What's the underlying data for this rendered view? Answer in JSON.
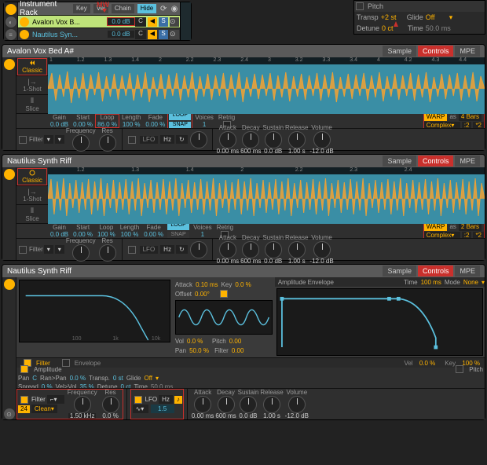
{
  "rack": {
    "title": "Instrument Rack",
    "buttons": {
      "key": "Key",
      "vel": "Vel",
      "chain": "Chain",
      "hide": "Hide"
    },
    "mw_label": "MW",
    "chains": [
      {
        "name": "Avalon Vox B...",
        "vol": "0.0 dB",
        "pan": "C",
        "mute": "",
        "solo": "S",
        "selected": true,
        "vol_hl": true
      },
      {
        "name": "Nautilus Syn...",
        "vol": "0.0 dB",
        "pan": "C",
        "mute": "",
        "solo": "S",
        "selected": false
      }
    ]
  },
  "pitch": {
    "header": "Pitch",
    "transp_label": "Transp",
    "transp_val": "+2 st",
    "glide_label": "Glide",
    "glide_val": "Off",
    "detune_label": "Detune",
    "detune_val": "0 ct",
    "time_label": "Time",
    "time_val": "50.0 ms"
  },
  "tabs": {
    "sample": "Sample",
    "controls": "Controls",
    "mpe": "MPE"
  },
  "left_tabs": {
    "classic": "Classic",
    "oneshot": "1-Shot",
    "slice": "Slice"
  },
  "knob_labels": {
    "gain": "Gain",
    "start": "Start",
    "loop": "Loop",
    "length": "Length",
    "fade": "Fade",
    "voices": "Voices",
    "retrig": "Retrig",
    "filter": "Filter",
    "freq": "Frequency",
    "res": "Res",
    "lfo": "LFO",
    "attack": "Attack",
    "decay": "Decay",
    "sustain": "Sustain",
    "release": "Release",
    "volume": "Volume",
    "vel": "Vel",
    "key": "Key",
    "vol": "Vol",
    "pitch": "Pitch",
    "pan": "Pan",
    "env": "Envelope",
    "offset": "Offset",
    "hz": "Hz",
    "rand": "R",
    "loop_btn": "LOOP",
    "snap_btn": "SNAP",
    "warp": "WARP",
    "as": "as",
    "complex": "Complex",
    "bars4": "4 Bars",
    "bars2": "2 Bars",
    "div2": ":2",
    "mul2": "*2",
    "clean": "Clean",
    "amp": "Amplitude",
    "amp_env": "Amplitude Envelope",
    "time": "Time",
    "mode": "Mode",
    "none": "None",
    "ran_pan": "Ran>Pan",
    "transp": "Transp.",
    "spread": "Spread",
    "vel_vol": "Vel>Vol",
    "detune": "Detune",
    "glide": "Glide"
  },
  "sampler1": {
    "title": "Avalon Vox Bed A#",
    "ruler": [
      "1",
      "1.2",
      "1.3",
      "1.4",
      "2",
      "2.2",
      "2.3",
      "2.4",
      "3",
      "3.2",
      "3.3",
      "3.4",
      "4",
      "4.2",
      "4.3",
      "4.4"
    ],
    "gain": "0.0 dB",
    "start": "0.00 %",
    "loop": "86.0 %",
    "length": "100 %",
    "fade": "0.00 %",
    "loop_on": true,
    "snap_on": true,
    "voices": "1",
    "retrig": "",
    "warp_on": true,
    "warp_mode": "Complex",
    "warp_bars": "4 Bars",
    "attack": "0.00 ms",
    "decay": "600 ms",
    "sustain": "0.0 dB",
    "release": "1.00 s",
    "volume": "-12.0 dB"
  },
  "sampler2": {
    "title": "Nautilus Synth Riff",
    "ruler": [
      "",
      "1.2",
      "",
      "1.3",
      "",
      "1.4",
      "",
      "2",
      "",
      "2.2",
      "",
      "2.3",
      "",
      "2.4",
      "",
      ""
    ],
    "gain": "0.0 dB",
    "start": "0.00 %",
    "loop": "100 %",
    "length": "100 %",
    "fade": "0.00 %",
    "loop_on": true,
    "snap_on": false,
    "voices": "1",
    "retrig": "",
    "warp_on": true,
    "warp_mode": "Complex",
    "warp_bars": "2 Bars",
    "attack": "0.00 ms",
    "decay": "600 ms",
    "sustain": "0.0 dB",
    "release": "1.00 s",
    "volume": "-12.0 dB"
  },
  "controls": {
    "title": "Nautilus Synth Riff",
    "lfo": {
      "attack": "0.10 ms",
      "key": "0.0 %",
      "offset": "0.00°",
      "vol": "0.0 %",
      "pitch": "0.00",
      "pan": "50.0 %",
      "filter": "0.00",
      "rate": "1.5"
    },
    "env": {
      "time": "100 ms",
      "mode": "None"
    },
    "amp": {
      "pan": "C",
      "ran_pan": "0.0 %",
      "transp": "0 st",
      "glide": "Off",
      "spread": "0 %",
      "vel_vol": "35 %",
      "detune": "0 ct",
      "time": "50.0 ms"
    },
    "filter": {
      "freq_val": "1.50 kHz",
      "res_val": "0.0 %",
      "vel": "0.0 %",
      "key": "100 %",
      "type": "24",
      "clean": "Clean"
    },
    "axis": {
      "a": "100",
      "b": "1k",
      "c": "10k"
    },
    "adsr": {
      "attack": "0.00 ms",
      "decay": "600 ms",
      "sustain": "0.0 dB",
      "release": "1.00 s",
      "volume": "-12.0 dB"
    }
  }
}
